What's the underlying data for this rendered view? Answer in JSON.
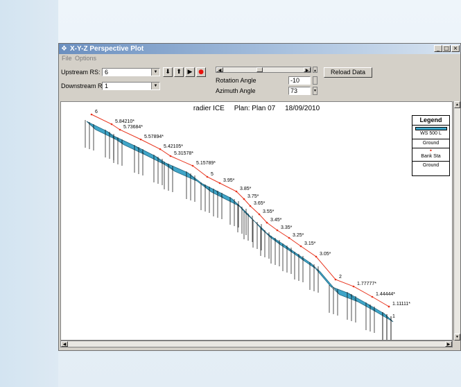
{
  "window": {
    "title": "X-Y-Z Perspective Plot"
  },
  "menu": [
    {
      "label": "File"
    },
    {
      "label": "Options"
    }
  ],
  "controls": {
    "upstream_label": "Upstream RS:",
    "upstream_value": "6",
    "downstream_label": "Downstream RS:",
    "downstream_value": "1",
    "rotation_label": "Rotation Angle",
    "rotation_value": "-10",
    "azimuth_label": "Azimuth Angle",
    "azimuth_value": "73",
    "reload_label": "Reload Data"
  },
  "plot": {
    "title": "radier ICE     Plan: Plan 07     18/09/2010",
    "stations": [
      {
        "label": "6"
      },
      {
        "label": "5.84210*"
      },
      {
        "label": "5.73684*"
      },
      {
        "label": "5.57894*"
      },
      {
        "label": "5.42105*"
      },
      {
        "label": "5.31578*"
      },
      {
        "label": "5.15789*"
      },
      {
        "label": "5"
      },
      {
        "label": "3.95*"
      },
      {
        "label": "3.85*"
      },
      {
        "label": "3.75*"
      },
      {
        "label": "3.65*"
      },
      {
        "label": "3.55*"
      },
      {
        "label": "3.45*"
      },
      {
        "label": "3.35*"
      },
      {
        "label": "3.25*"
      },
      {
        "label": "3.15*"
      },
      {
        "label": "3.05*"
      },
      {
        "label": "2"
      },
      {
        "label": "1.77777*"
      },
      {
        "label": "1.44444*"
      },
      {
        "label": "1.11111*"
      },
      {
        "label": "1"
      }
    ],
    "legend": {
      "title": "Legend",
      "items": [
        {
          "label": "WS 500 L",
          "color": "#3fa5c8"
        },
        {
          "label": "Ground",
          "color": "#000000"
        },
        {
          "label": "Bank Sta",
          "color": "#e8331c"
        },
        {
          "label": "Ground",
          "color": "#000000"
        }
      ]
    }
  }
}
